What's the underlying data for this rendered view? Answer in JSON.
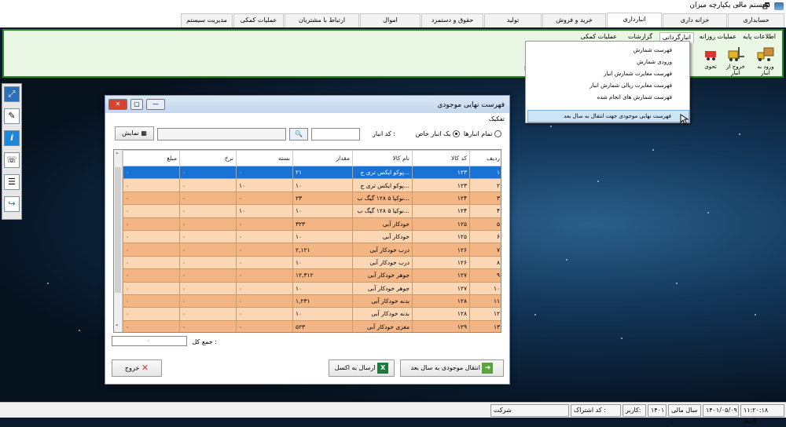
{
  "window": {
    "title": "سیستم مالی یکپارچه میزان",
    "maximize_glyph": "🗗",
    "minimize_glyph": "—"
  },
  "menu": [
    "حسابداری",
    "خزانه داری",
    "انبارداری",
    "خرید و فروش",
    "تولید",
    "حقوق و دستمزد",
    "اموال",
    "ارتباط با مشتریان",
    "عملیات کمکی",
    "مدیریت سیستم"
  ],
  "ribbon": {
    "subtabs": [
      "اطلاعات پایه",
      "عملیات روزانه",
      "انبارگردانی",
      "گزارشات",
      "عملیات کمکی"
    ],
    "buttons": [
      "ورود به انبار",
      "خروج از انبار",
      "تحوی"
    ],
    "left_fragment": "ا"
  },
  "dropdown": [
    "فهرست شمارش",
    "ورودی شمارش",
    "فهرست مغایرت شمارش انبار",
    "فهرست مغایرت ریالی شمارش انبار",
    "فهرست شمارش های انجام شده",
    "فهرست نهایی موجودی جهت انتقال به سال بعد"
  ],
  "dialog": {
    "title": "فهرست نهایی موجودی",
    "group_label": "تفکیک",
    "radio_all": "تمام انبارها",
    "radio_one": "یک انبار خاص",
    "warehouse_code_label": "کد انبار :",
    "show_button": "نمایش",
    "columns": [
      "ردیف",
      "کد کالا",
      "نام کالا",
      "مقدار",
      "بسته",
      "نرخ",
      "مبلغ"
    ],
    "rows": [
      [
        "۱",
        "۱۲۳",
        "پوکو ایکس تری ج...",
        "۲۱",
        "۰",
        "۰",
        "۰"
      ],
      [
        "۲",
        "۱۲۳",
        "پوکو ایکس تری ج...",
        "۱۰",
        "۱۰",
        "۰",
        "۰"
      ],
      [
        "۳",
        "۱۲۴",
        "نوکیا ۵ ۱۲۸ گیگ ب...",
        "۲۳",
        "۰",
        "۰",
        "۰"
      ],
      [
        "۴",
        "۱۲۴",
        "نوکیا ۵ ۱۲۸ گیگ ب...",
        "۱۰",
        "۱۰",
        "۰",
        "۰"
      ],
      [
        "۵",
        "۱۲۵",
        "خودکار آبی",
        "۳۲۳",
        "۰",
        "۰",
        "۰"
      ],
      [
        "۶",
        "۱۲۵",
        "خودکار آبی",
        "۱۰",
        "۰",
        "۰",
        "۰"
      ],
      [
        "۷",
        "۱۲۶",
        "درب خودکار آبی",
        "۲,۱۲۱",
        "۰",
        "۰",
        "۰"
      ],
      [
        "۸",
        "۱۲۶",
        "درب خودکار آبی",
        "۱۰",
        "۰",
        "۰",
        "۰"
      ],
      [
        "۹",
        "۱۲۷",
        "جوهر خودکار آبی",
        "۱۲,۳۱۲",
        "۰",
        "۰",
        "۰"
      ],
      [
        "۱۰",
        "۱۲۷",
        "جوهر خودکار آبی",
        "۱۰",
        "۰",
        "۰",
        "۰"
      ],
      [
        "۱۱",
        "۱۲۸",
        "بدنه خودکار آبی",
        "۱,۲۳۱",
        "۰",
        "۰",
        "۰"
      ],
      [
        "۱۲",
        "۱۲۸",
        "بدنه خودکار آبی",
        "۱۰",
        "۰",
        "۰",
        "۰"
      ],
      [
        "۱۳",
        "۱۲۹",
        "مغزی خودکار آبی",
        "۵۲۳",
        "۰",
        "۰",
        "۰"
      ]
    ],
    "total_label": "جمع کل :",
    "total_value": "۰",
    "transfer_button": "انتقال موجودی به سال بعد",
    "excel_button": "ارسال به اکسل",
    "exit_button": "خروج"
  },
  "status": {
    "time": "۱۱:۲۰:۱۸ ق.ظ",
    "date": "۱۴۰۱/۰۵/۰۹",
    "fiscal_label": "سال مالی :",
    "fiscal_year": "۱۴۰۱",
    "user_label": "کاربر:",
    "sub_label": "کد اشتراک :",
    "company_label": "شرکت"
  },
  "colors": {
    "ribbon_border": "#1f8a1f",
    "row_odd": "#f4b584",
    "row_even": "#fbd7b6",
    "row_selected": "#1a73d4"
  }
}
